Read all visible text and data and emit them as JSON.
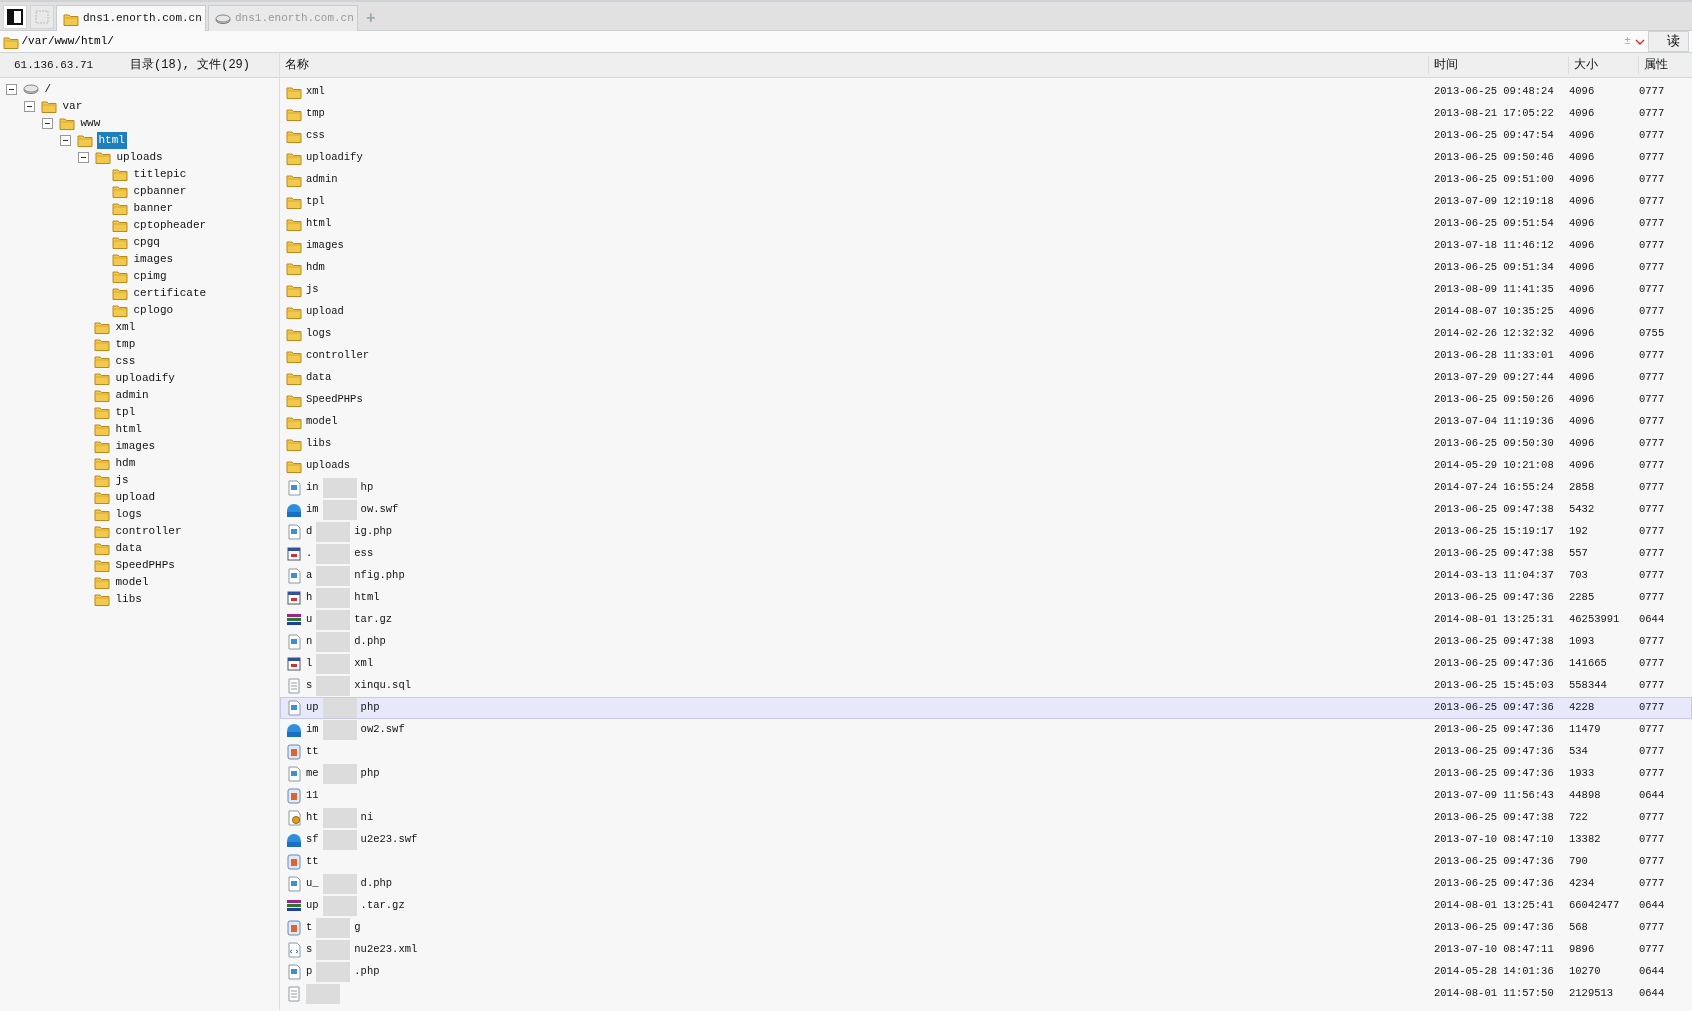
{
  "tabs": [
    {
      "label": "dns1.enorth.com.cn",
      "kind": "folder",
      "selected": true
    },
    {
      "label": "dns1.enorth.com.cn",
      "kind": "drive",
      "selected": false
    }
  ],
  "new_tab": "+",
  "path_bar": {
    "value": "/var/www/html/",
    "history_symbol": "±",
    "read_button": "读"
  },
  "host": "61.136.63.71",
  "summary": "目录(18), 文件(29)",
  "columns": [
    "名称",
    "时间",
    "大小",
    "属性"
  ],
  "tree": [
    {
      "label": "/",
      "kind": "drive",
      "selected": false,
      "expanded": true,
      "children": [
        {
          "label": "var",
          "kind": "folder",
          "selected": false,
          "expanded": true,
          "children": [
            {
              "label": "www",
              "kind": "folder",
              "selected": false,
              "expanded": true,
              "children": [
                {
                  "label": "html",
                  "kind": "folder",
                  "selected": true,
                  "expanded": true,
                  "children": [
                    {
                      "label": "uploads",
                      "kind": "folder",
                      "selected": false,
                      "expanded": true,
                      "children": [
                        {
                          "label": "titlepic",
                          "kind": "folder",
                          "selected": false
                        },
                        {
                          "label": "cpbanner",
                          "kind": "folder",
                          "selected": false
                        },
                        {
                          "label": "banner",
                          "kind": "folder",
                          "selected": false
                        },
                        {
                          "label": "cptopheader",
                          "kind": "folder",
                          "selected": false
                        },
                        {
                          "label": "cpgq",
                          "kind": "folder",
                          "selected": false
                        },
                        {
                          "label": "images",
                          "kind": "folder",
                          "selected": false
                        },
                        {
                          "label": "cpimg",
                          "kind": "folder",
                          "selected": false
                        },
                        {
                          "label": "certificate",
                          "kind": "folder",
                          "selected": false
                        },
                        {
                          "label": "cplogo",
                          "kind": "folder",
                          "selected": false
                        }
                      ]
                    },
                    {
                      "label": "xml",
                      "kind": "folder",
                      "selected": false
                    },
                    {
                      "label": "tmp",
                      "kind": "folder",
                      "selected": false
                    },
                    {
                      "label": "css",
                      "kind": "folder",
                      "selected": false
                    },
                    {
                      "label": "uploadify",
                      "kind": "folder",
                      "selected": false
                    },
                    {
                      "label": "admin",
                      "kind": "folder",
                      "selected": false
                    },
                    {
                      "label": "tpl",
                      "kind": "folder",
                      "selected": false
                    },
                    {
                      "label": "html",
                      "kind": "folder",
                      "selected": false
                    },
                    {
                      "label": "images",
                      "kind": "folder",
                      "selected": false
                    },
                    {
                      "label": "hdm",
                      "kind": "folder",
                      "selected": false
                    },
                    {
                      "label": "js",
                      "kind": "folder",
                      "selected": false
                    },
                    {
                      "label": "upload",
                      "kind": "folder",
                      "selected": false
                    },
                    {
                      "label": "logs",
                      "kind": "folder",
                      "selected": false
                    },
                    {
                      "label": "controller",
                      "kind": "folder",
                      "selected": false
                    },
                    {
                      "label": "data",
                      "kind": "folder",
                      "selected": false
                    },
                    {
                      "label": "SpeedPHPs",
                      "kind": "folder",
                      "selected": false
                    },
                    {
                      "label": "model",
                      "kind": "folder",
                      "selected": false
                    },
                    {
                      "label": "libs",
                      "kind": "folder",
                      "selected": false
                    }
                  ]
                }
              ]
            }
          ]
        }
      ]
    }
  ],
  "files": [
    {
      "name_parts": [
        "xml"
      ],
      "kind": "folder",
      "time": "2013-06-25 09:48:24",
      "size": "4096",
      "attr": "0777",
      "selected": false
    },
    {
      "name_parts": [
        "tmp"
      ],
      "kind": "folder",
      "time": "2013-08-21 17:05:22",
      "size": "4096",
      "attr": "0777",
      "selected": false
    },
    {
      "name_parts": [
        "css"
      ],
      "kind": "folder",
      "time": "2013-06-25 09:47:54",
      "size": "4096",
      "attr": "0777",
      "selected": false
    },
    {
      "name_parts": [
        "uploadify"
      ],
      "kind": "folder",
      "time": "2013-06-25 09:50:46",
      "size": "4096",
      "attr": "0777",
      "selected": false
    },
    {
      "name_parts": [
        "admin"
      ],
      "kind": "folder",
      "time": "2013-06-25 09:51:00",
      "size": "4096",
      "attr": "0777",
      "selected": false
    },
    {
      "name_parts": [
        "tpl"
      ],
      "kind": "folder",
      "time": "2013-07-09 12:19:18",
      "size": "4096",
      "attr": "0777",
      "selected": false
    },
    {
      "name_parts": [
        "html"
      ],
      "kind": "folder",
      "time": "2013-06-25 09:51:54",
      "size": "4096",
      "attr": "0777",
      "selected": false
    },
    {
      "name_parts": [
        "images"
      ],
      "kind": "folder",
      "time": "2013-07-18 11:46:12",
      "size": "4096",
      "attr": "0777",
      "selected": false
    },
    {
      "name_parts": [
        "hdm"
      ],
      "kind": "folder",
      "time": "2013-06-25 09:51:34",
      "size": "4096",
      "attr": "0777",
      "selected": false
    },
    {
      "name_parts": [
        "js"
      ],
      "kind": "folder",
      "time": "2013-08-09 11:41:35",
      "size": "4096",
      "attr": "0777",
      "selected": false
    },
    {
      "name_parts": [
        "upload"
      ],
      "kind": "folder",
      "time": "2014-08-07 10:35:25",
      "size": "4096",
      "attr": "0777",
      "selected": false
    },
    {
      "name_parts": [
        "logs"
      ],
      "kind": "folder",
      "time": "2014-02-26 12:32:32",
      "size": "4096",
      "attr": "0755",
      "selected": false
    },
    {
      "name_parts": [
        "controller"
      ],
      "kind": "folder",
      "time": "2013-06-28 11:33:01",
      "size": "4096",
      "attr": "0777",
      "selected": false
    },
    {
      "name_parts": [
        "data"
      ],
      "kind": "folder",
      "time": "2013-07-29 09:27:44",
      "size": "4096",
      "attr": "0777",
      "selected": false
    },
    {
      "name_parts": [
        "SpeedPHPs"
      ],
      "kind": "folder",
      "time": "2013-06-25 09:50:26",
      "size": "4096",
      "attr": "0777",
      "selected": false
    },
    {
      "name_parts": [
        "model"
      ],
      "kind": "folder",
      "time": "2013-07-04 11:19:36",
      "size": "4096",
      "attr": "0777",
      "selected": false
    },
    {
      "name_parts": [
        "libs"
      ],
      "kind": "folder",
      "time": "2013-06-25 09:50:30",
      "size": "4096",
      "attr": "0777",
      "selected": false
    },
    {
      "name_parts": [
        "uploads"
      ],
      "kind": "folder",
      "time": "2014-05-29 10:21:08",
      "size": "4096",
      "attr": "0777",
      "selected": false
    },
    {
      "name_parts": [
        "in",
        "hp"
      ],
      "kind": "php",
      "time": "2014-07-24 16:55:24",
      "size": "2858",
      "attr": "0777",
      "selected": false
    },
    {
      "name_parts": [
        "im",
        "ow.swf"
      ],
      "kind": "swf",
      "time": "2013-06-25 09:47:38",
      "size": "5432",
      "attr": "0777",
      "selected": false
    },
    {
      "name_parts": [
        "d",
        "ig.php"
      ],
      "kind": "php",
      "time": "2013-06-25 15:19:17",
      "size": "192",
      "attr": "0777",
      "selected": false
    },
    {
      "name_parts": [
        ".",
        "ess"
      ],
      "kind": "web",
      "time": "2013-06-25 09:47:38",
      "size": "557",
      "attr": "0777",
      "selected": false
    },
    {
      "name_parts": [
        "a",
        "nfig.php"
      ],
      "kind": "php",
      "time": "2014-03-13 11:04:37",
      "size": "703",
      "attr": "0777",
      "selected": false
    },
    {
      "name_parts": [
        "h",
        "html"
      ],
      "kind": "web",
      "time": "2013-06-25 09:47:36",
      "size": "2285",
      "attr": "0777",
      "selected": false
    },
    {
      "name_parts": [
        "u",
        "tar.gz"
      ],
      "kind": "archive",
      "time": "2014-08-01 13:25:31",
      "size": "46253991",
      "attr": "0644",
      "selected": false
    },
    {
      "name_parts": [
        "n",
        "d.php"
      ],
      "kind": "php",
      "time": "2013-06-25 09:47:38",
      "size": "1093",
      "attr": "0777",
      "selected": false
    },
    {
      "name_parts": [
        "l",
        "xml"
      ],
      "kind": "web",
      "time": "2013-06-25 09:47:36",
      "size": "141665",
      "attr": "0777",
      "selected": false
    },
    {
      "name_parts": [
        "s",
        "xinqu.sql"
      ],
      "kind": "text",
      "time": "2013-06-25 15:45:03",
      "size": "558344",
      "attr": "0777",
      "selected": false
    },
    {
      "name_parts": [
        "up",
        "php"
      ],
      "kind": "php",
      "time": "2013-06-25 09:47:36",
      "size": "4228",
      "attr": "0777",
      "selected": true
    },
    {
      "name_parts": [
        "im",
        "ow2.swf"
      ],
      "kind": "swf",
      "time": "2013-06-25 09:47:36",
      "size": "11479",
      "attr": "0777",
      "selected": false
    },
    {
      "name_parts": [
        "tt"
      ],
      "kind": "image",
      "time": "2013-06-25 09:47:36",
      "size": "534",
      "attr": "0777",
      "selected": false
    },
    {
      "name_parts": [
        "me",
        "php"
      ],
      "kind": "php",
      "time": "2013-06-25 09:47:36",
      "size": "1933",
      "attr": "0777",
      "selected": false
    },
    {
      "name_parts": [
        "11"
      ],
      "kind": "image",
      "time": "2013-07-09 11:56:43",
      "size": "44898",
      "attr": "0644",
      "selected": false
    },
    {
      "name_parts": [
        "ht",
        "ni"
      ],
      "kind": "config",
      "time": "2013-06-25 09:47:38",
      "size": "722",
      "attr": "0777",
      "selected": false
    },
    {
      "name_parts": [
        "sf",
        "u2e23.swf"
      ],
      "kind": "swf",
      "time": "2013-07-10 08:47:10",
      "size": "13382",
      "attr": "0777",
      "selected": false
    },
    {
      "name_parts": [
        "tt"
      ],
      "kind": "image",
      "time": "2013-06-25 09:47:36",
      "size": "790",
      "attr": "0777",
      "selected": false
    },
    {
      "name_parts": [
        "u_",
        "d.php"
      ],
      "kind": "php",
      "time": "2013-06-25 09:47:36",
      "size": "4234",
      "attr": "0777",
      "selected": false
    },
    {
      "name_parts": [
        "up",
        ".tar.gz"
      ],
      "kind": "archive",
      "time": "2014-08-01 13:25:41",
      "size": "66042477",
      "attr": "0644",
      "selected": false
    },
    {
      "name_parts": [
        "t",
        "g"
      ],
      "kind": "image",
      "time": "2013-06-25 09:47:36",
      "size": "568",
      "attr": "0777",
      "selected": false
    },
    {
      "name_parts": [
        "s",
        "nu2e23.xml"
      ],
      "kind": "xml",
      "time": "2013-07-10 08:47:11",
      "size": "9896",
      "attr": "0777",
      "selected": false
    },
    {
      "name_parts": [
        "p",
        ".php"
      ],
      "kind": "php",
      "time": "2014-05-28 14:01:36",
      "size": "10270",
      "attr": "0644",
      "selected": false
    },
    {
      "kind": "text",
      "time": "2014-08-01 11:57:50",
      "size": "2129513",
      "attr": "0644",
      "selected": false
    }
  ]
}
